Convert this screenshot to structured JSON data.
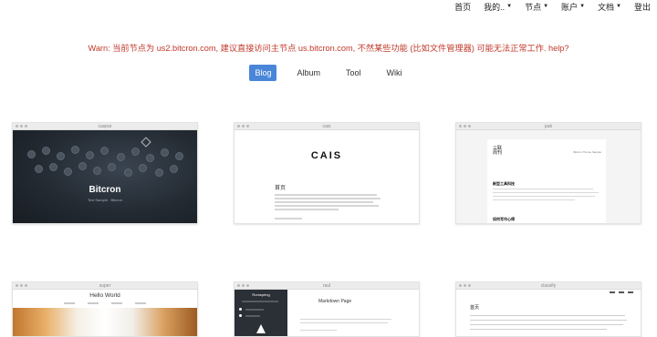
{
  "nav": {
    "items": [
      {
        "label": "首页",
        "has_caret": false
      },
      {
        "label": "我的..",
        "has_caret": true
      },
      {
        "label": "节点",
        "has_caret": true
      },
      {
        "label": "账户",
        "has_caret": true
      },
      {
        "label": "文档",
        "has_caret": true
      },
      {
        "label": "登出",
        "has_caret": false
      }
    ]
  },
  "warning": {
    "prefix": "Warn: 当前节点为 us2.bitcron.com, 建议直接访问主节点 ",
    "link": "us.bitcron.com",
    "middle": ", 不然某些功能 (比如文件管理器) 可能无法正常工作. ",
    "help": "help?"
  },
  "tabs": [
    {
      "label": "Blog",
      "active": true
    },
    {
      "label": "Album",
      "active": false
    },
    {
      "label": "Tool",
      "active": false
    },
    {
      "label": "Wiki",
      "active": false
    }
  ],
  "themes": [
    {
      "name": "caspar",
      "brand": "Bitcron",
      "subtitle": "Text Sample · Bitcron"
    },
    {
      "name": "cais",
      "logo": "CAIS",
      "title": "首页"
    },
    {
      "name": "pub",
      "title": "三联\n周刊",
      "right_text": "Bitcron Theme Sample",
      "heading1": "新型工具科技",
      "heading2": "如何写作心得"
    },
    {
      "name": "super",
      "title": "Hello World"
    },
    {
      "name": "raul",
      "side_name": "Rumspring",
      "title": "Markdown Page"
    },
    {
      "name": "classify",
      "title": "首页"
    }
  ],
  "colors": {
    "warn": "#c0392b",
    "tab_active_bg": "#4a86d8",
    "tab_active_text": "#ffffff"
  }
}
